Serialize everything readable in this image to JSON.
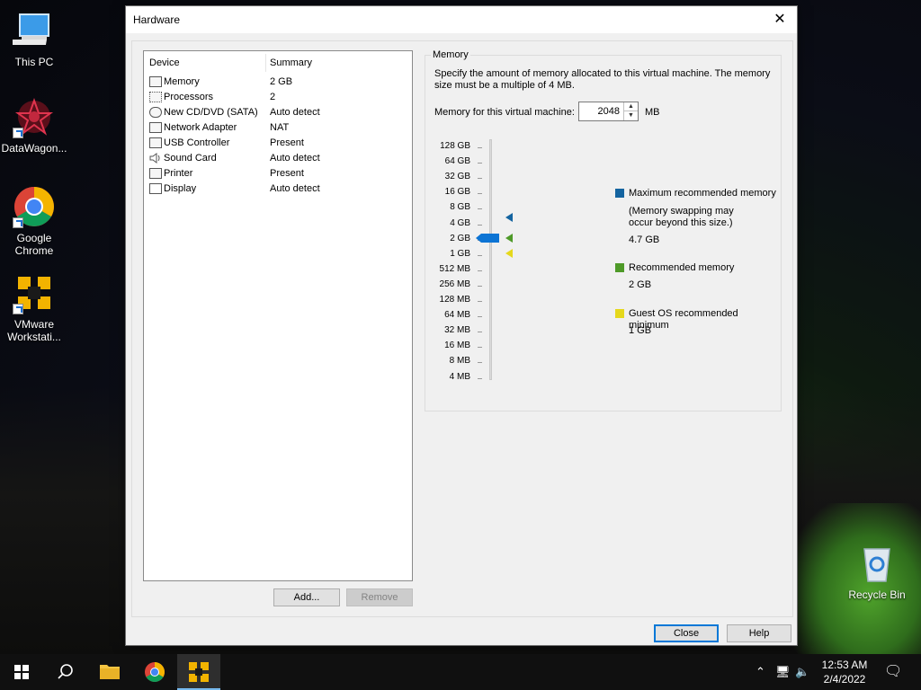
{
  "desktop": {
    "icons": [
      {
        "label": "This PC"
      },
      {
        "label": "DataWagon..."
      },
      {
        "label": "Google\nChrome"
      },
      {
        "label": "VMware\nWorkstati..."
      },
      {
        "label": "Recycle Bin"
      }
    ]
  },
  "dialog": {
    "title": "Hardware",
    "device_table": {
      "headers": [
        "Device",
        "Summary"
      ],
      "rows": [
        {
          "device": "Memory",
          "summary": "2 GB"
        },
        {
          "device": "Processors",
          "summary": "2"
        },
        {
          "device": "New CD/DVD (SATA)",
          "summary": "Auto detect"
        },
        {
          "device": "Network Adapter",
          "summary": "NAT"
        },
        {
          "device": "USB Controller",
          "summary": "Present"
        },
        {
          "device": "Sound Card",
          "summary": "Auto detect"
        },
        {
          "device": "Printer",
          "summary": "Present"
        },
        {
          "device": "Display",
          "summary": "Auto detect"
        }
      ]
    },
    "buttons": {
      "add": "Add...",
      "remove": "Remove",
      "close": "Close",
      "help": "Help"
    },
    "memory": {
      "group_title": "Memory",
      "description": "Specify the amount of memory allocated to this virtual machine. The memory size must be a multiple of 4 MB.",
      "field_label": "Memory for this virtual machine:",
      "value": "2048",
      "unit": "MB",
      "scale": [
        "128 GB",
        "64 GB",
        "32 GB",
        "16 GB",
        "8 GB",
        "4 GB",
        "2 GB",
        "1 GB",
        "512 MB",
        "256 MB",
        "128 MB",
        "64 MB",
        "32 MB",
        "16 MB",
        "8 MB",
        "4 MB"
      ],
      "legend": {
        "max_title": "Maximum recommended memory",
        "max_note": "(Memory swapping may occur beyond this size.)",
        "max_value": "4.7 GB",
        "rec_title": "Recommended memory",
        "rec_value": "2 GB",
        "min_title": "Guest OS recommended minimum",
        "min_value": "1 GB"
      },
      "colors": {
        "max": "#1464a0",
        "rec": "#4e9a28",
        "min": "#e5d81c",
        "thumb": "#0c74d4"
      }
    }
  },
  "taskbar": {
    "time": "12:53 AM",
    "date": "2/4/2022"
  }
}
